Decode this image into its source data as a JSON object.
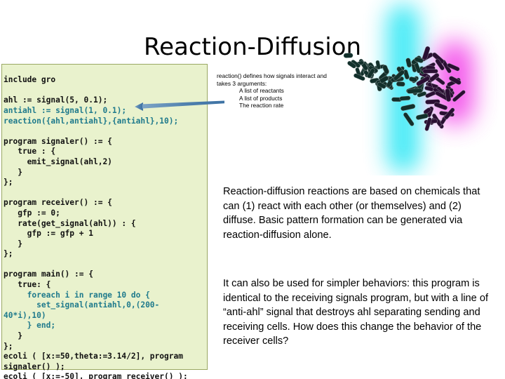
{
  "slide": {
    "title": "Reaction-Diffusion",
    "background_color": "#ffffff"
  },
  "code_panel": {
    "background_color": "#e9f2cd",
    "border_color": "#9aa863",
    "language": "gro",
    "lines": [
      "include gro",
      "",
      "ahl := signal(5, 0.1);",
      "antiahl := signal(1, 0.1);",
      "reaction({ahl,antiahl},{antiahl},10);",
      "",
      "program signaler() := {",
      "   true : {",
      "     emit_signal(ahl,2)",
      "   }",
      "};",
      "",
      "program receiver() := {",
      "   gfp := 0;",
      "   rate(get_signal(ahl)) : {",
      "     gfp := gfp + 1",
      "   }",
      "};",
      "",
      "program main() := {",
      "   true: {",
      "     foreach i in range 10 do {",
      "       set_signal(antiahl,0,(200-",
      "40*i),10)",
      "     } end;",
      "   }",
      "};",
      "ecoli ( [x:=50,theta:=3.14/2], program",
      "signaler() );",
      "ecoli ( [x:=-50], program receiver() );"
    ]
  },
  "callout": {
    "arrow_color": "#4a7fac",
    "arrow_direction": "left",
    "intro": "reaction() defines how signals interact and takes 3 arguments:",
    "arguments": [
      "A list of reactants",
      "A list of products",
      "The reaction rate"
    ]
  },
  "figure": {
    "name": "reaction-diffusion-simulation",
    "signal_cyan_color": "#33e8f5",
    "signal_magenta_color": "#f23ce8",
    "cell_color_left": "#12302b",
    "cell_color_right": "#2a0f33",
    "cell_count": 96
  },
  "body": {
    "paragraph_1": "Reaction-diffusion reactions are based on chemicals that can (1) react with each other (or themselves) and (2) diffuse. Basic pattern formation can be generated via reaction-diffusion alone.",
    "paragraph_2": "It can also be used for simpler behaviors: this program is identical to the receiving signals program, but with a line of “anti-ahl” signal that destroys ahl separating sending and receiving cells. How does this change the behavior of the receiver cells?"
  }
}
